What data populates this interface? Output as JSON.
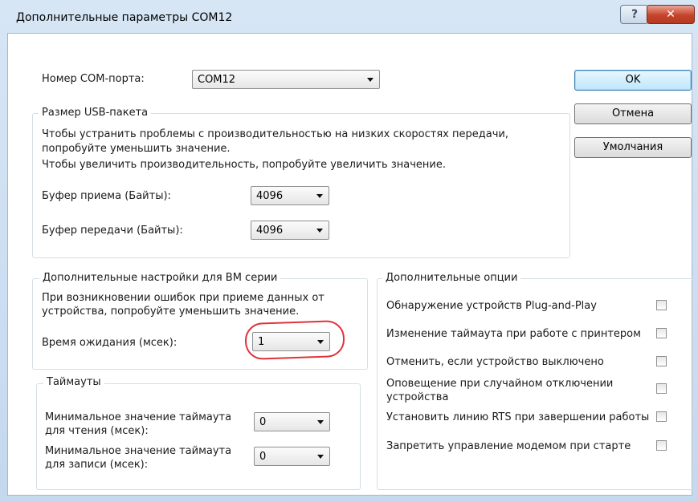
{
  "window": {
    "title": "Дополнительные параметры COM12",
    "help_glyph": "?",
    "close_glyph": "✕"
  },
  "port": {
    "label": "Номер COM-порта:",
    "value": "COM12"
  },
  "buttons": {
    "ok": "OK",
    "cancel": "Отмена",
    "defaults": "Умолчания"
  },
  "usb": {
    "title": "Размер USB-пакета",
    "desc1": "Чтобы устранить проблемы с производительностью на низких скоростях передачи,",
    "desc2": "попробуйте уменьшить значение.",
    "desc3": "Чтобы увеличить производительность, попробуйте увеличить значение.",
    "rx_label": "Буфер приема (Байты):",
    "rx_value": "4096",
    "tx_label": "Буфер передачи (Байты):",
    "tx_value": "4096"
  },
  "bm": {
    "title": "Дополнительные настройки для BM серии",
    "desc1": "При возникновении ошибок при приеме данных от",
    "desc2": "устройства, попробуйте уменьшить значение.",
    "latency_label": "Время ожидания (мсек):",
    "latency_value": "1"
  },
  "timeouts": {
    "title": "Таймауты",
    "read_label1": "Минимальное значение таймаута",
    "read_label2": "для чтения (мсек):",
    "read_value": "0",
    "write_label1": "Минимальное значение таймаута",
    "write_label2": "для записи (мсек):",
    "write_value": "0"
  },
  "options": {
    "title": "Дополнительные опции",
    "pnp": "Обнаружение устройств Plug-and-Play",
    "printer": "Изменение таймаута при работе с принтером",
    "cancel_off": "Отменить, если устройство выключено",
    "surprise1": "Оповещение при случайном отключении",
    "surprise2": "устройства",
    "rts": "Установить линию RTS при завершении работы",
    "modem": "Запретить управление модемом при старте"
  },
  "colors": {
    "highlight": "#e0323a",
    "ok_border": "#3c7fb1"
  }
}
